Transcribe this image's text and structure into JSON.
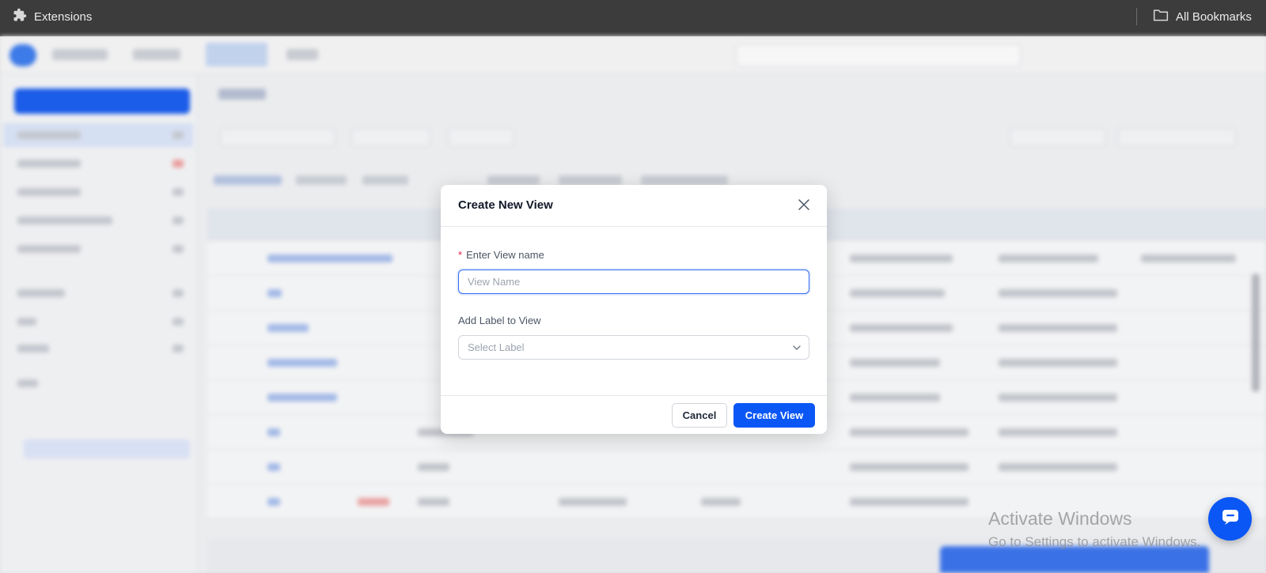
{
  "browser": {
    "extensions_label": "Extensions",
    "bookmarks_label": "All Bookmarks",
    "icons": {
      "extensions": "puzzle-icon",
      "bookmarks": "folder-icon"
    }
  },
  "modal": {
    "title": "Create New View",
    "view_name_label": "Enter View name",
    "required_marker": "*",
    "view_name_value": "",
    "view_name_placeholder": "View Name",
    "label_field_label": "Add Label to View",
    "label_select_placeholder": "Select Label",
    "cancel_label": "Cancel",
    "create_label": "Create View",
    "icons": {
      "close": "close-icon",
      "select": "chevron-down-icon"
    }
  },
  "watermark": {
    "line1": "Activate Windows",
    "line2": "Go to Settings to activate Windows."
  },
  "chat": {
    "icon": "chat-icon"
  },
  "colors": {
    "primary": "#0b57f5",
    "required": "#e11d48",
    "topbar": "#3c3c3c"
  }
}
